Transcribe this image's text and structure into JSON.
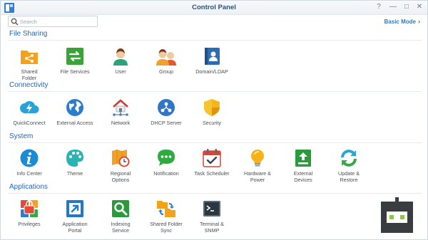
{
  "window": {
    "title": "Control Panel",
    "controls": [
      "?",
      "—",
      "□",
      "✕"
    ]
  },
  "search": {
    "placeholder": "Search"
  },
  "basic_mode": {
    "label": "Basic Mode"
  },
  "sections": {
    "file_sharing": {
      "title": "File Sharing",
      "items": [
        "Shared\nFolder",
        "File Services",
        "User",
        "Group",
        "Domain/LDAP"
      ]
    },
    "connectivity": {
      "title": "Connectivity",
      "items": [
        "QuickConnect",
        "External Access",
        "Network",
        "DHCP Server",
        "Security"
      ]
    },
    "system": {
      "title": "System",
      "items": [
        "Info Center",
        "Theme",
        "Regional\nOptions",
        "Notification",
        "Task Scheduler",
        "Hardware &\nPower",
        "External\nDevices",
        "Update &\nRestore"
      ]
    },
    "applications": {
      "title": "Applications",
      "items": [
        "Privileges",
        "Application\nPortal",
        "Indexing\nService",
        "Shared Folder\nSync",
        "Terminal &\nSNMP"
      ]
    }
  }
}
